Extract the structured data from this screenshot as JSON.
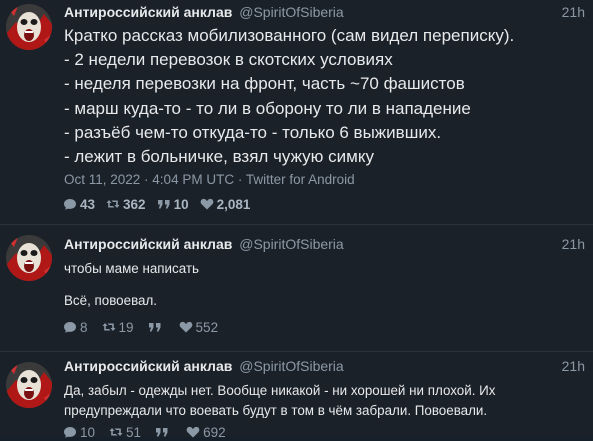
{
  "tweets": [
    {
      "author_name": "Антироссийский анклав",
      "handle": "@SpiritOfSiberia",
      "time": "21h",
      "lines": [
        "Кратко рассказ мобилизованного (сам видел переписку).",
        "- 2 недели перевозок в скотских условиях",
        "- неделя перевозки на фронт, часть ~70 фашистов",
        "- марш куда-то - то ли в оборону то ли в нападение",
        "- разъёб чем-то откуда-то - только 6 выживших.",
        "- лежит в больничке, взял чужую симку"
      ],
      "meta": "Oct 11, 2022 · 4:04 PM UTC · Twitter for Android",
      "stats": {
        "replies": "43",
        "retweets": "362",
        "quotes": "10",
        "likes": "2,081"
      }
    },
    {
      "author_name": "Антироссийский анклав",
      "handle": "@SpiritOfSiberia",
      "time": "21h",
      "paragraph_1": "чтобы маме написать",
      "paragraph_2": "Всё, повоевал.",
      "stats": {
        "replies": "8",
        "retweets": "19",
        "quotes": "",
        "likes": "552"
      }
    },
    {
      "author_name": "Антироссийский анклав",
      "handle": "@SpiritOfSiberia",
      "time": "21h",
      "paragraph_1": "Да, забыл - одежды нет. Вообще никакой - ни хорошей ни плохой. Их предупреждали что воевать будут в том в чём забрали. Повоевали.",
      "stats": {
        "replies": "10",
        "retweets": "51",
        "quotes": "",
        "likes": "692"
      }
    }
  ],
  "icons": {
    "reply": "comment-icon",
    "retweet": "retweet-icon",
    "quote": "quote-icon",
    "like": "heart-icon"
  },
  "colors": {
    "background": "#1b2129",
    "text": "#e7e9ea",
    "muted": "#8b98a5"
  }
}
